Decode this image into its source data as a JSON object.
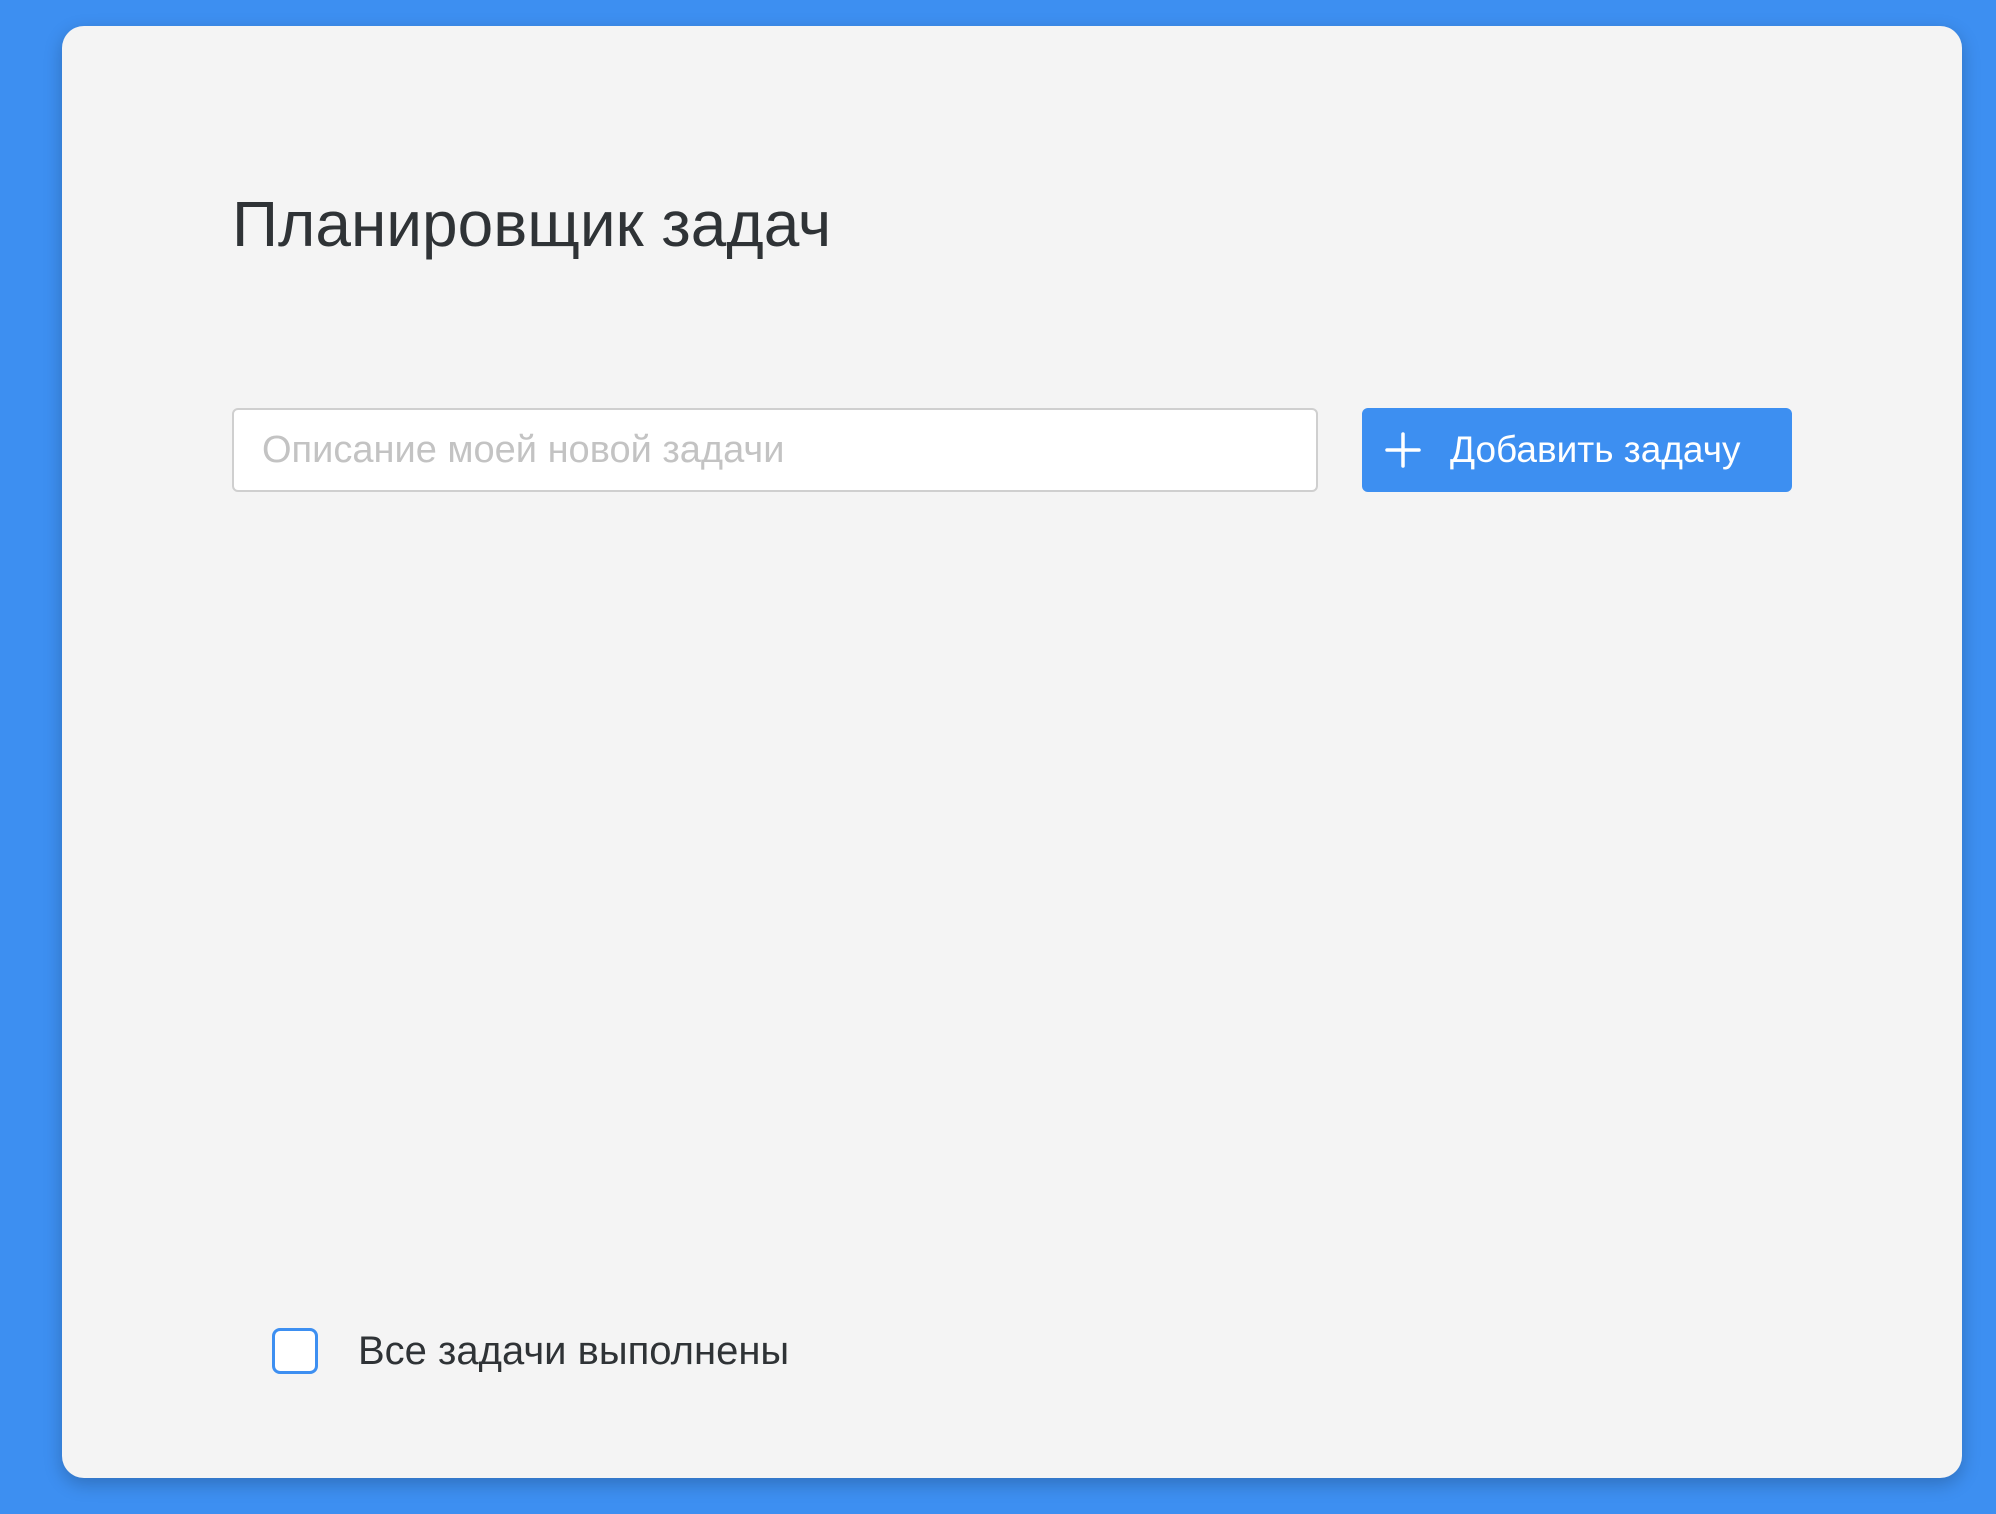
{
  "app": {
    "title": "Планировщик задач"
  },
  "new_task": {
    "placeholder": "Описание моей новой задачи",
    "value": "",
    "add_button_label": "Добавить задачу",
    "add_button_icon": "plus-icon"
  },
  "footer": {
    "all_done_label": "Все задачи выполнены",
    "all_done_checked": false
  },
  "colors": {
    "background": "#3d8ff1",
    "card": "#f4f4f4",
    "accent": "#3d8ff1",
    "text": "#2f3336",
    "placeholder": "#c3c3c3"
  }
}
